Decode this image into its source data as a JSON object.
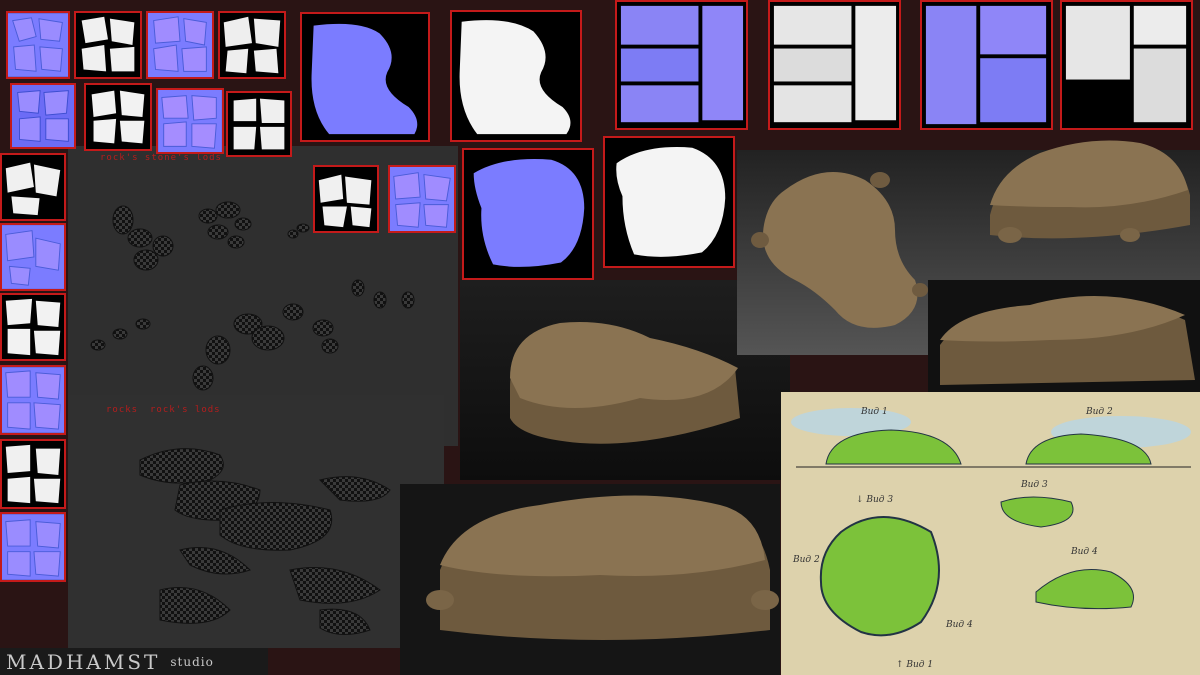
{
  "labels": {
    "rocks_stone_lods": "rock's stone's lods",
    "rocks": "rocks",
    "rocks_lods": "rock's lods"
  },
  "studio": {
    "brand": "MADHAMST",
    "sub": "studio"
  },
  "concept": {
    "top_left": "Вид 1",
    "top_right": "Вид 2",
    "mid_top": "Вид 3",
    "arrow_3": "↓ Вид 3",
    "arrow_2": "Вид 2",
    "mid_right": "Вид 4",
    "bottom_right": "Вид 4",
    "bottom": "↑ Вид 1"
  },
  "colors": {
    "normal_map": "#7b7cff",
    "ao_map": "#f2f2f2",
    "frame": "#c41a1a",
    "clay": "#8a7352",
    "grass": "#7cc23a"
  }
}
